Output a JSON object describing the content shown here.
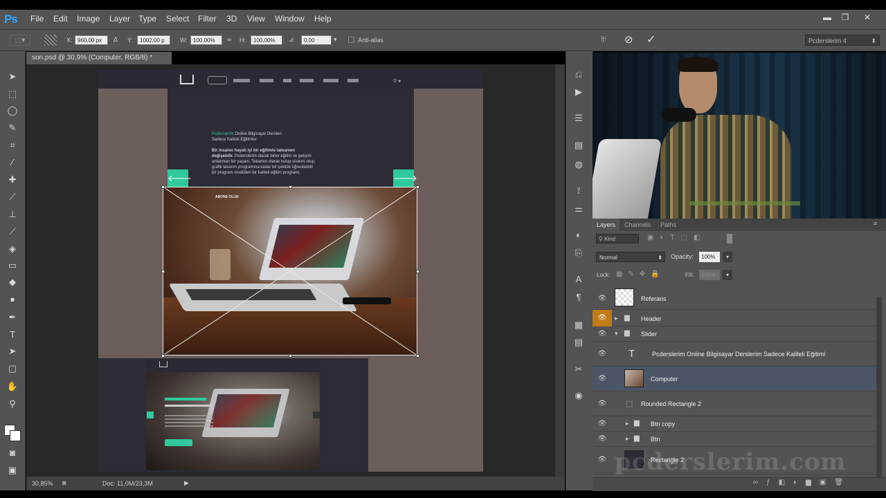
{
  "app": {
    "logo": "Ps"
  },
  "menu": [
    "File",
    "Edit",
    "Image",
    "Layer",
    "Type",
    "Select",
    "Filter",
    "3D",
    "View",
    "Window",
    "Help"
  ],
  "window_controls": [
    "▬",
    "❐",
    "✕"
  ],
  "options": {
    "x_label": "X:",
    "x_value": "960,00 px",
    "y_label": "Y:",
    "y_value": "1002,00 p",
    "w_label": "W:",
    "w_value": "100,00%",
    "h_label": "H:",
    "h_value": "100,00%",
    "angle_value": "0,00",
    "antialias": "Anti-alias",
    "workspace": "Pcderslerim 4"
  },
  "document": {
    "tab": "son.psd @ 30,9% (Computer, RGB/8) *",
    "zoom": "30,85%",
    "doc_size": "Doc: 11,0M/23,3M"
  },
  "canvas": {
    "hero_headline_green": "Pcderslerim",
    "hero_headline_rest": " Online Bilgisayar Dersleri",
    "hero_headline_line2": "Sadece Kaliteli Eğitimler",
    "hero_body_bold": "Bir insanın hayatı iyi bir eğitimle tamamen değişebilir.",
    "hero_body": " Pcderslerim olarak birler eğitim ve gelişim anlatırken bir yaşam. Tekarten olarak kutup sistemi olup, grafik tasarım programına kadar bir şekilde öğrenilebilir bir program modülleri bir kaliteli eğitim programı.",
    "photo_caption": "ABONE OLUN",
    "left_arrow": "🡐",
    "right_arrow": "🡒"
  },
  "panel_tabs": [
    "Layers",
    "Channels",
    "Paths"
  ],
  "layers_controls": {
    "kind": "Kind",
    "blend_mode": "Normal",
    "opacity_label": "Opacity:",
    "opacity_value": "100%",
    "lock_label": "Lock:",
    "fill_label": "Fill:",
    "fill_value": "100%"
  },
  "layers": [
    {
      "name": "Referans"
    },
    {
      "name": "Header"
    },
    {
      "name": "Slider"
    },
    {
      "name": "Pcderslerim Online Bilgisayar Derslerim Sadece Kaliteli Eğitiml"
    },
    {
      "name": "Computer"
    },
    {
      "name": "Rounded Rectangle 2"
    },
    {
      "name": "Btn copy"
    },
    {
      "name": "Btn"
    },
    {
      "name": "Rectangle 2"
    }
  ],
  "watermark": "pcderslerim.com",
  "colors": {
    "accent": "#2fc99c",
    "ps_blue": "#31a8ff",
    "selected_layer": "#4b5565",
    "eye_active": "#c27a16"
  }
}
